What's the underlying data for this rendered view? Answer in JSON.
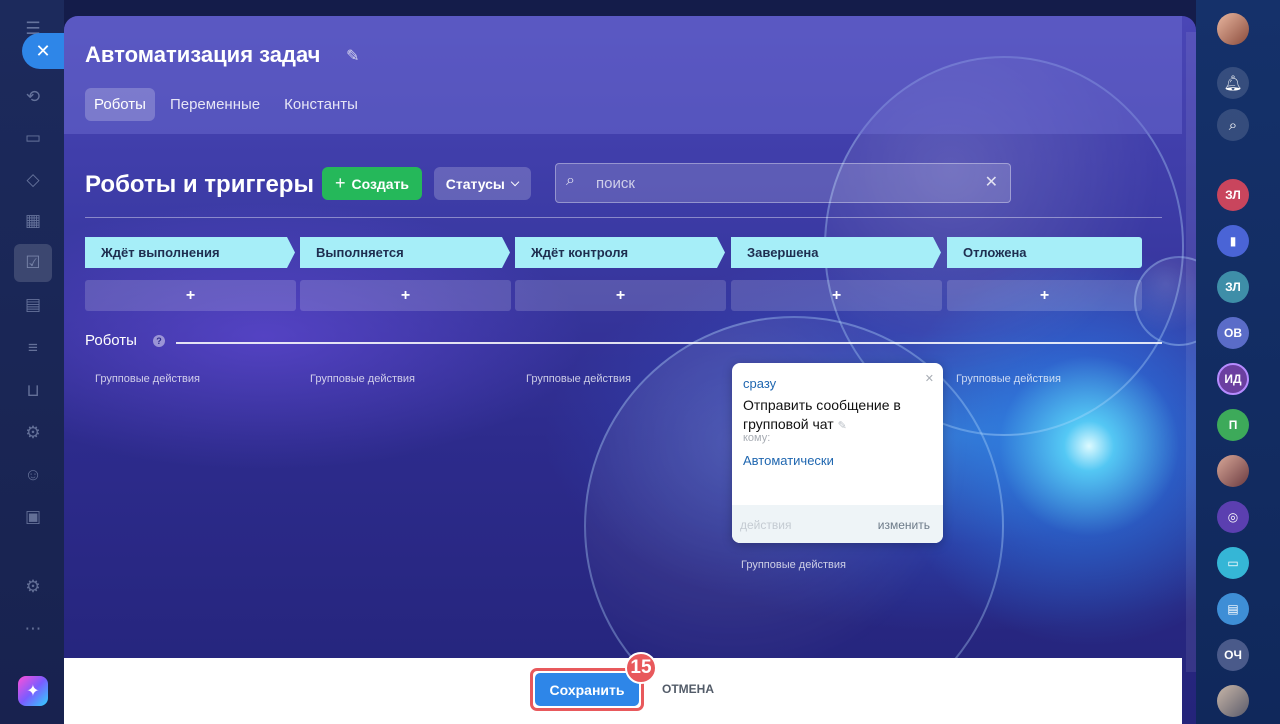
{
  "window": {
    "title": "Автоматизация задач",
    "tabs": [
      {
        "label": "Роботы",
        "active": true
      },
      {
        "label": "Переменные",
        "active": false
      },
      {
        "label": "Константы",
        "active": false
      }
    ]
  },
  "toolbar": {
    "section_title": "Роботы и триггеры",
    "create_label": "Создать",
    "statuses_label": "Статусы",
    "search_placeholder": "поиск"
  },
  "stages": [
    {
      "label": "Ждёт выполнения"
    },
    {
      "label": "Выполняется"
    },
    {
      "label": "Ждёт контроля"
    },
    {
      "label": "Завершена"
    },
    {
      "label": "Отложена"
    }
  ],
  "add_symbol": "+",
  "robots": {
    "label": "Роботы",
    "help": "?",
    "group_actions_label": "Групповые действия"
  },
  "robot_card": {
    "when": "сразу",
    "name": "Отправить сообщение в групповой чат",
    "to_label": "кому:",
    "to_value": "Автоматически",
    "actions_label": "действия",
    "change_label": "изменить"
  },
  "footer": {
    "save_label": "Сохранить",
    "cancel_label": "ОТМЕНА",
    "step_badge": "15"
  },
  "right_rail": {
    "avatars": [
      "ЗЛ",
      "ЗЛ",
      "ОВ",
      "ИД",
      "П",
      "ОЧ"
    ]
  },
  "colors": {
    "stage_bg": "#a6eef8",
    "create_green": "#25b85a",
    "save_blue": "#2e86e8",
    "badge_red": "#e8595c"
  }
}
